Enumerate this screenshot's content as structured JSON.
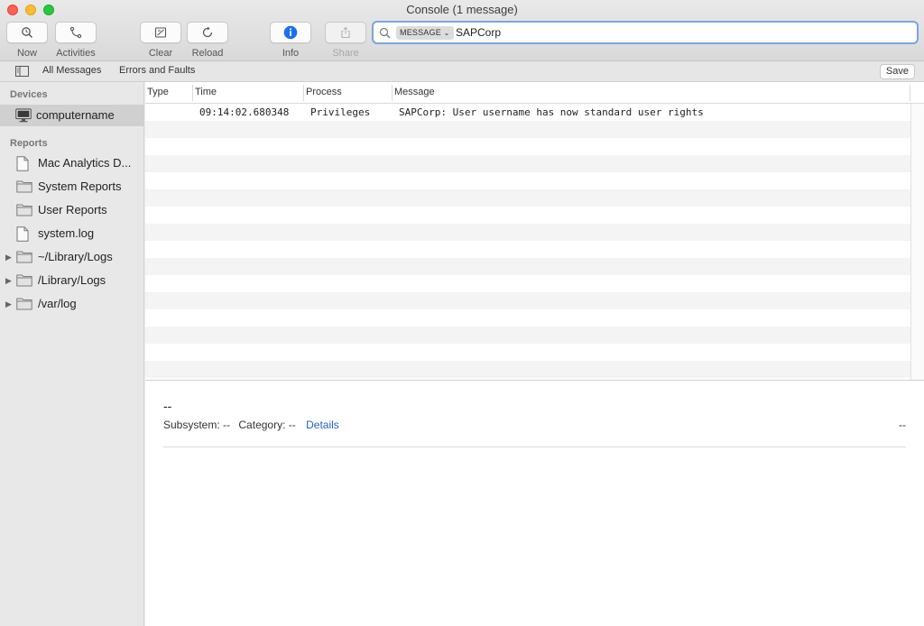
{
  "window": {
    "title": "Console (1 message)"
  },
  "toolbar": {
    "now": "Now",
    "activities": "Activities",
    "clear": "Clear",
    "reload": "Reload",
    "info": "Info",
    "share": "Share"
  },
  "search": {
    "token": "MESSAGE",
    "value": "SAPCorp"
  },
  "filters": {
    "all": "All Messages",
    "errors": "Errors and Faults",
    "save": "Save"
  },
  "sidebar": {
    "devices_heading": "Devices",
    "device": "computername",
    "reports_heading": "Reports",
    "reports": [
      "Mac Analytics D...",
      "System Reports",
      "User Reports",
      "system.log",
      "~/Library/Logs",
      "/Library/Logs",
      "/var/log"
    ]
  },
  "table": {
    "columns": {
      "type": "Type",
      "time": "Time",
      "process": "Process",
      "message": "Message"
    },
    "rows": [
      {
        "type": "",
        "time": "09:14:02.680348",
        "process": "Privileges",
        "message": "SAPCorp: User username has now standard user rights"
      }
    ]
  },
  "detail": {
    "title": "--",
    "subsystem_label": "Subsystem:",
    "subsystem_value": "--",
    "category_label": "Category:",
    "category_value": "--",
    "details_link": "Details",
    "right_value": "--"
  },
  "colors": {
    "accent": "#1f62c9",
    "info": "#1a6ef5",
    "search_focus": "#7ba3e2"
  }
}
